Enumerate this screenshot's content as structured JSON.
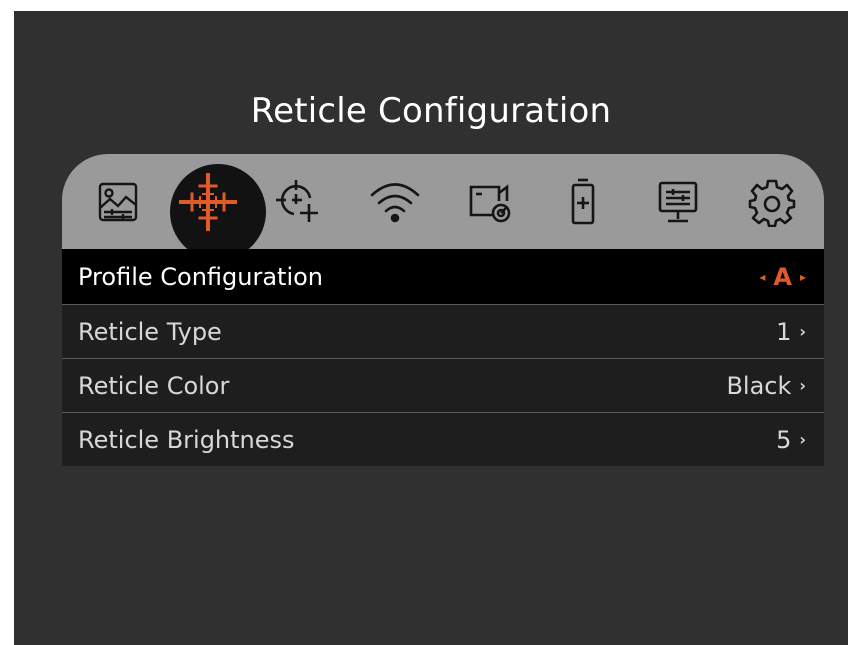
{
  "title": "Reticle Configuration",
  "accent_color": "#e05a2a",
  "tabs": [
    {
      "icon": "image-adjust-icon",
      "active": false
    },
    {
      "icon": "reticle-icon",
      "active": true
    },
    {
      "icon": "zeroing-icon",
      "active": false
    },
    {
      "icon": "wifi-icon",
      "active": false
    },
    {
      "icon": "record-settings-icon",
      "active": false
    },
    {
      "icon": "battery-icon",
      "active": false
    },
    {
      "icon": "display-settings-icon",
      "active": false
    },
    {
      "icon": "gear-icon",
      "active": false
    }
  ],
  "menu": {
    "items": [
      {
        "label": "Profile Configuration",
        "value": "A",
        "selected": true
      },
      {
        "label": "Reticle Type",
        "value": "1"
      },
      {
        "label": "Reticle Color",
        "value": "Black"
      },
      {
        "label": "Reticle Brightness",
        "value": "5"
      }
    ]
  },
  "glyphs": {
    "prev": "◂",
    "next": "▸",
    "chevron": "›"
  }
}
